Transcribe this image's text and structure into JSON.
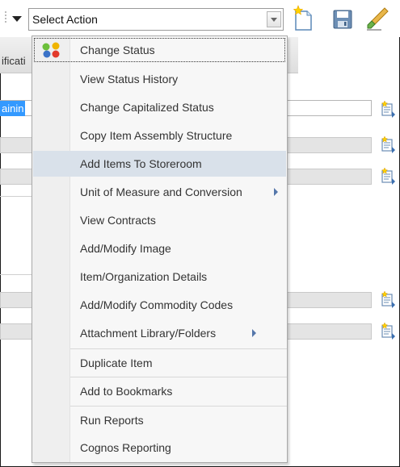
{
  "toolbar": {
    "select_value": "Select Action",
    "icons": [
      "new-record-icon",
      "save-icon",
      "clear-changes-icon"
    ]
  },
  "form": {
    "tab_label": "ificati",
    "selected_text": "ainin"
  },
  "menu": {
    "items": [
      {
        "label": "Change Status",
        "icon": "status-icon",
        "focused": true
      },
      {
        "label": "View Status History"
      },
      {
        "label": "Change Capitalized Status"
      },
      {
        "label": "Copy Item Assembly Structure"
      },
      {
        "label": "Add Items To Storeroom",
        "highlighted": true
      },
      {
        "label": "Unit of Measure and Conversion",
        "submenu": true
      },
      {
        "label": "View Contracts"
      },
      {
        "label": "Add/Modify Image"
      },
      {
        "label": "Item/Organization Details"
      },
      {
        "label": "Add/Modify Commodity Codes"
      },
      {
        "label": "Attachment Library/Folders",
        "submenu": true
      },
      {
        "label": "Duplicate Item"
      },
      {
        "label": "Add to Bookmarks"
      },
      {
        "label": "Run Reports"
      },
      {
        "label": "Cognos Reporting"
      }
    ]
  },
  "colors": {
    "selection": "#3399ff",
    "menu_hover": "#d9e1ea",
    "submenu_arrow": "#5577aa"
  }
}
